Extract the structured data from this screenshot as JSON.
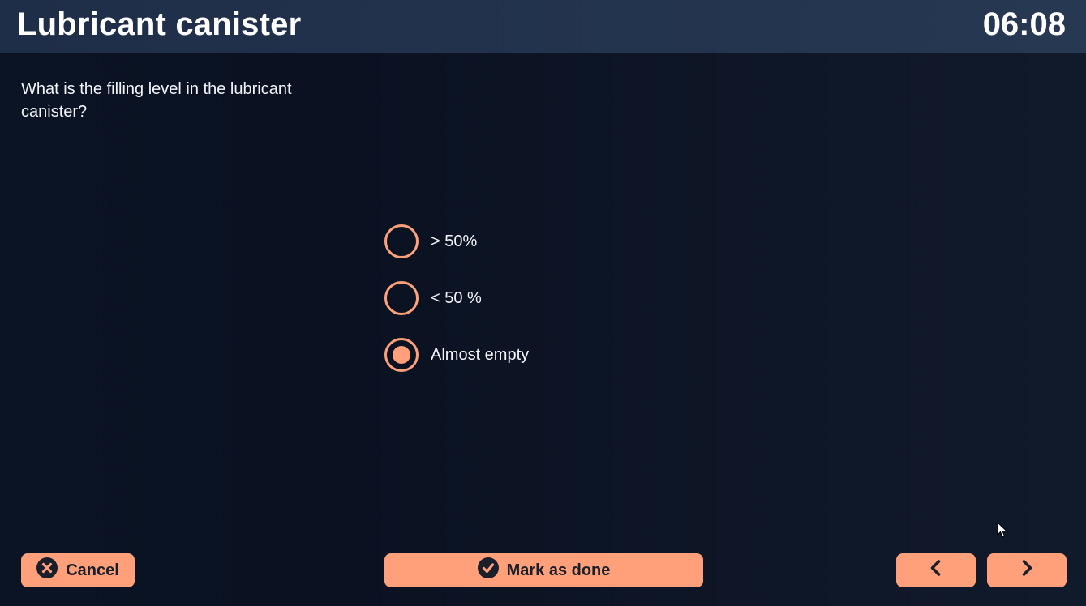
{
  "header": {
    "title": "Lubricant canister",
    "time": "06:08"
  },
  "question": "What is the filling level in the lubricant canister?",
  "options": [
    {
      "label": "> 50%",
      "selected": false
    },
    {
      "label": "< 50 %",
      "selected": false
    },
    {
      "label": "Almost empty",
      "selected": true
    }
  ],
  "footer": {
    "cancel_label": "Cancel",
    "done_label": "Mark as done",
    "cancel_icon": "close-circle-icon",
    "done_icon": "check-circle-icon",
    "prev_icon": "chevron-left-icon",
    "next_icon": "chevron-right-icon"
  },
  "colors": {
    "accent": "#ffa07a",
    "header_bg": "#263852",
    "background": "#0b1424"
  }
}
